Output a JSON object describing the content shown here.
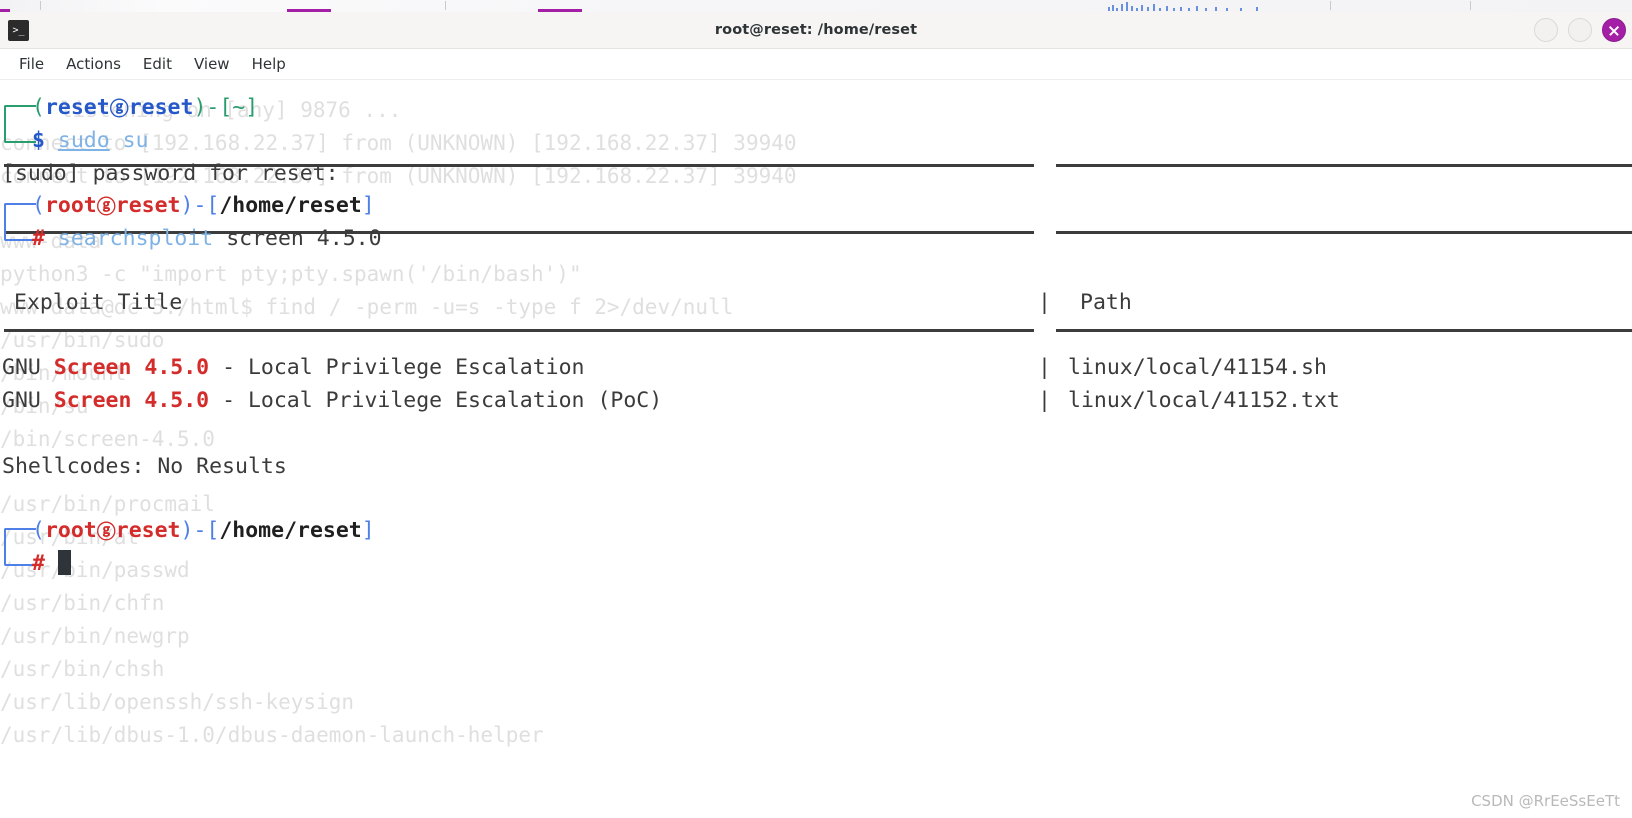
{
  "outer_bar": {
    "accent_color": "#a31fa6"
  },
  "window": {
    "title": "root@reset: /home/reset",
    "app_icon": "terminal-icon",
    "controls": [
      {
        "name": "minimize-button",
        "glyph": ""
      },
      {
        "name": "maximize-button",
        "glyph": ""
      },
      {
        "name": "close-button",
        "glyph": "✕"
      }
    ]
  },
  "menubar": {
    "items": [
      {
        "label": "File"
      },
      {
        "label": "Actions"
      },
      {
        "label": "Edit"
      },
      {
        "label": "View"
      },
      {
        "label": "Help"
      }
    ]
  },
  "colors": {
    "user_prompt": "#2a9d6e",
    "user_name": "#2558c8",
    "root_prompt": "#4f80e8",
    "root_name": "#d42b2b",
    "path": "#1f1f1f",
    "command": "#7fb2e5",
    "match_highlight": "#d42b2b",
    "body_text": "#3b3b3b",
    "ghost_text": "#dadada",
    "close_button": "#a31fa6"
  },
  "terminal": {
    "prompt_user": {
      "open_paren": "(",
      "user": "reset",
      "at_glyph": "ⓖ",
      "host": "reset",
      "close_paren": ")",
      "dash": "-",
      "open_bracket": "[",
      "cwd": "~",
      "close_bracket": "]",
      "sigil": "$"
    },
    "prompt_root": {
      "open_paren": "(",
      "user": "root",
      "at_glyph": "ⓖ",
      "host": "reset",
      "close_paren": ")",
      "dash": "-",
      "open_bracket": "[",
      "cwd": "/home/reset",
      "close_bracket": "]",
      "sigil": "#"
    },
    "cmd_sudo": {
      "sudo": "sudo",
      "arg": " su"
    },
    "sudo_password_prompt": "[sudo] password for reset:",
    "cmd_searchsploit": {
      "program": "searchsploit",
      "args": " screen 4.5.0"
    },
    "table": {
      "header_title": "Exploit Title",
      "header_pipe": "|",
      "header_path": "Path",
      "rows": [
        {
          "title_pre": "GNU ",
          "title_match": "Screen 4.5.0",
          "title_post": " - Local Privilege Escalation",
          "pipe": "|",
          "path": "linux/local/41154.sh"
        },
        {
          "title_pre": "GNU ",
          "title_match": "Screen 4.5.0",
          "title_post": " - Local Privilege Escalation (PoC)",
          "pipe": "|",
          "path": "linux/local/41152.txt"
        }
      ]
    },
    "shellcodes_result": "Shellcodes: No Results",
    "ghost_lines": [
      "listening on [any] 9876 ...",
      "connect to [192.168.22.37] from (UNKNOWN) [192.168.22.37] 39940",
      "connect to [192.168.22.37] from (UNKNOWN) [192.168.22.37] 39940",
      "www-data",
      "python3 -c \"import pty;pty.spawn('/bin/bash')\"",
      "www-data@dc-5:/html$ find / -perm -u=s -type f 2>/dev/null",
      "/usr/bin/sudo",
      "/bin/mount",
      "/bin/su",
      "/bin/screen-4.5.0",
      "/usr/bin/procmail",
      "/usr/bin/at",
      "/usr/bin/passwd",
      "/usr/bin/chfn",
      "/usr/bin/newgrp",
      "/usr/bin/chsh",
      "/usr/lib/openssh/ssh-keysign",
      "/usr/lib/dbus-1.0/dbus-daemon-launch-helper"
    ]
  },
  "watermark": "CSDN @RrEeSsEeTt"
}
